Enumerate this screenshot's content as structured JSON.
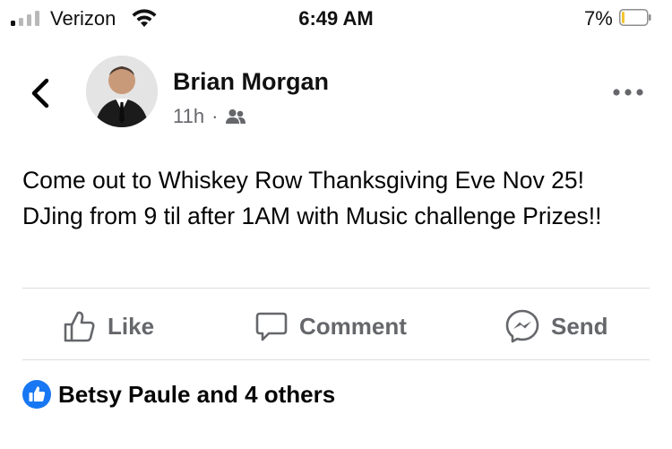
{
  "status_bar": {
    "carrier": "Verizon",
    "time": "6:49 AM",
    "battery_percent": "7%",
    "signal_bars_active": 1,
    "signal_bars_total": 4,
    "battery_level": 0.07
  },
  "post": {
    "author": "Brian Morgan",
    "timestamp": "11h",
    "separator": "·",
    "audience_icon": "friends-icon",
    "text": "Come out to Whiskey Row Thanksgiving Eve Nov 25!  DJing from 9 til after 1AM with Music challenge Prizes!!"
  },
  "actions": {
    "like_label": "Like",
    "comment_label": "Comment",
    "send_label": "Send"
  },
  "reactions": {
    "summary": "Betsy Paule and 4 others",
    "icon": "like-reaction-icon"
  },
  "colors": {
    "secondary_text": "#65676b",
    "like_blue": "#1877f2",
    "battery_low": "#f4c430",
    "divider": "#dadde1"
  }
}
